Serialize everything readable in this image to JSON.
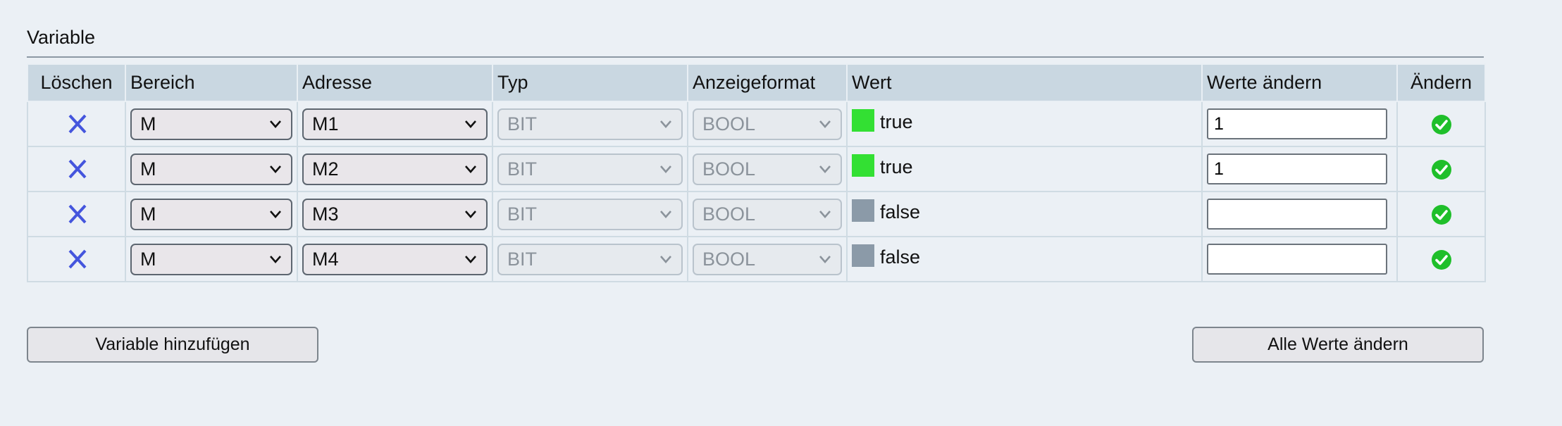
{
  "section": {
    "title": "Variable"
  },
  "table": {
    "headers": {
      "delete": "Löschen",
      "area": "Bereich",
      "address": "Adresse",
      "type": "Typ",
      "format": "Anzeigeformat",
      "value": "Wert",
      "new_value": "Werte ändern",
      "apply": "Ändern"
    },
    "rows": [
      {
        "area": "M",
        "address": "M1",
        "type": "BIT",
        "format": "BOOL",
        "value": "true",
        "state": "on",
        "new_value": "1"
      },
      {
        "area": "M",
        "address": "M2",
        "type": "BIT",
        "format": "BOOL",
        "value": "true",
        "state": "on",
        "new_value": "1"
      },
      {
        "area": "M",
        "address": "M3",
        "type": "BIT",
        "format": "BOOL",
        "value": "false",
        "state": "off",
        "new_value": ""
      },
      {
        "area": "M",
        "address": "M4",
        "type": "BIT",
        "format": "BOOL",
        "value": "false",
        "state": "off",
        "new_value": ""
      }
    ],
    "icons": {
      "delete": "delete-x-icon",
      "apply": "green-check-icon",
      "dropdown": "chevron-down-icon"
    }
  },
  "buttons": {
    "add_variable": "Variable hinzufügen",
    "apply_all": "Alle Werte ändern"
  },
  "colors": {
    "state_on": "#33e033",
    "state_off": "#8b9aa8",
    "delete_icon": "#4455dd",
    "apply_icon": "#1fbf2a",
    "header_bg": "#c9d7e1",
    "page_bg": "#ebf0f5"
  }
}
